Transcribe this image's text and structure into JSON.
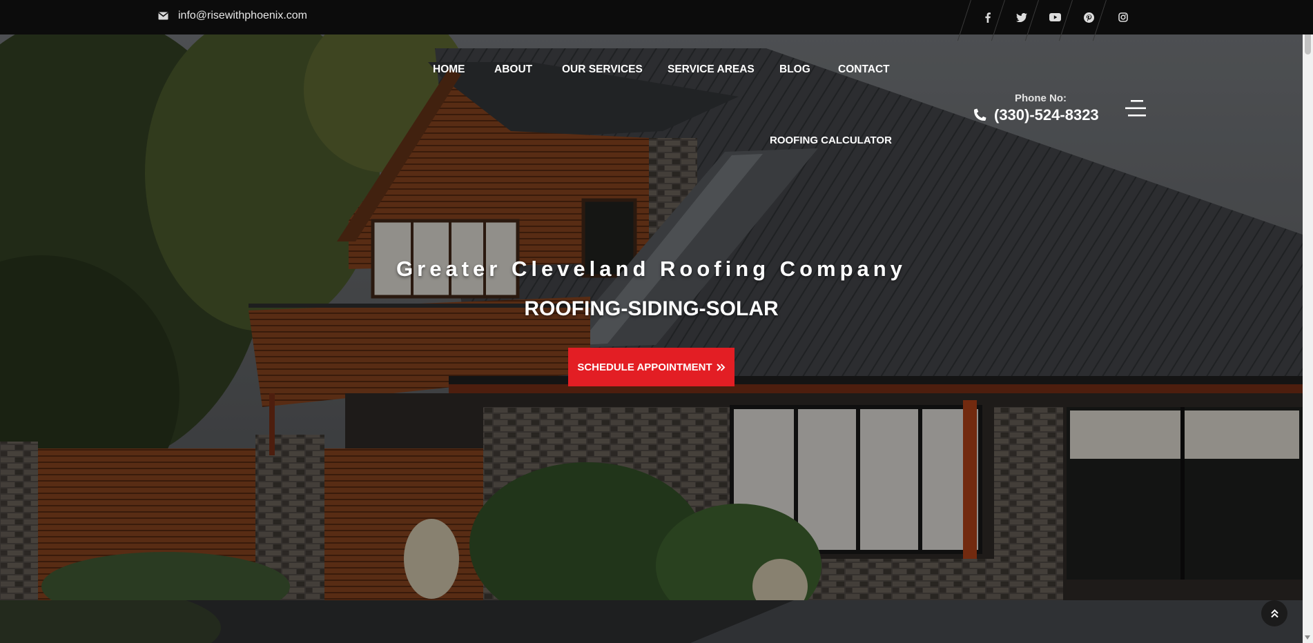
{
  "topbar": {
    "email": "info@risewithphoenix.com",
    "email_icon": "envelope-icon",
    "social_icons": [
      "facebook-icon",
      "twitter-icon",
      "youtube-icon",
      "pinterest-icon",
      "instagram-icon"
    ]
  },
  "nav": {
    "items": [
      {
        "label": "HOME"
      },
      {
        "label": "ABOUT"
      },
      {
        "label": "OUR SERVICES"
      },
      {
        "label": "SERVICE AREAS"
      },
      {
        "label": "BLOG"
      },
      {
        "label": "CONTACT"
      },
      {
        "label": "ROOFING CALCULATOR"
      }
    ]
  },
  "phone": {
    "label": "Phone No:",
    "number": "(330)-524-8323",
    "icon": "phone-icon"
  },
  "hero": {
    "tagline": "Greater Cleveland Roofing Company",
    "subline": "ROOFING-SIDING-SOLAR",
    "cta_label": "SCHEDULE APPOINTMENT",
    "cta_icon": "double-chevron-right-icon"
  },
  "colors": {
    "accent": "#e31e24",
    "topbar_bg": "#0c0c0c"
  }
}
